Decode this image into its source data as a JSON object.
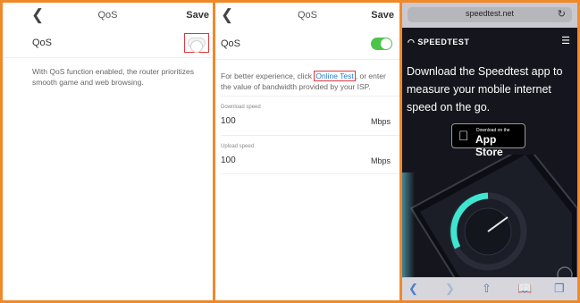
{
  "panel1": {
    "back_icon": "chevron-left-icon",
    "title": "QoS",
    "save_label": "Save",
    "qos_label": "QoS",
    "qos_enabled": false,
    "description": "With QoS function enabled, the router prioritizes smooth game and web browsing."
  },
  "panel2": {
    "back_icon": "chevron-left-icon",
    "title": "QoS",
    "save_label": "Save",
    "qos_label": "QoS",
    "qos_enabled": true,
    "hint_before": "For better experience, click ",
    "hint_link": "Online Test",
    "hint_after": ", or enter the value of bandwidth provided by your ISP.",
    "download": {
      "label": "Download speed",
      "value": "100",
      "unit": "Mbps"
    },
    "upload": {
      "label": "Upload speed",
      "value": "100",
      "unit": "Mbps"
    }
  },
  "panel3": {
    "url": "speedtest.net",
    "logo": "SPEEDTEST",
    "headline": "Download the Speedtest app to measure your mobile internet speed on the go.",
    "appstore_small": "Download on the",
    "appstore_big": "App Store",
    "colors": {
      "background": "#15161d",
      "gauge": "#3ee6d0",
      "accent": "#f0892a"
    }
  },
  "colors": {
    "frame": "#f0892a",
    "toggle_on": "#4cc44c",
    "link": "#1f7bd6",
    "highlight": "#e0393c"
  }
}
